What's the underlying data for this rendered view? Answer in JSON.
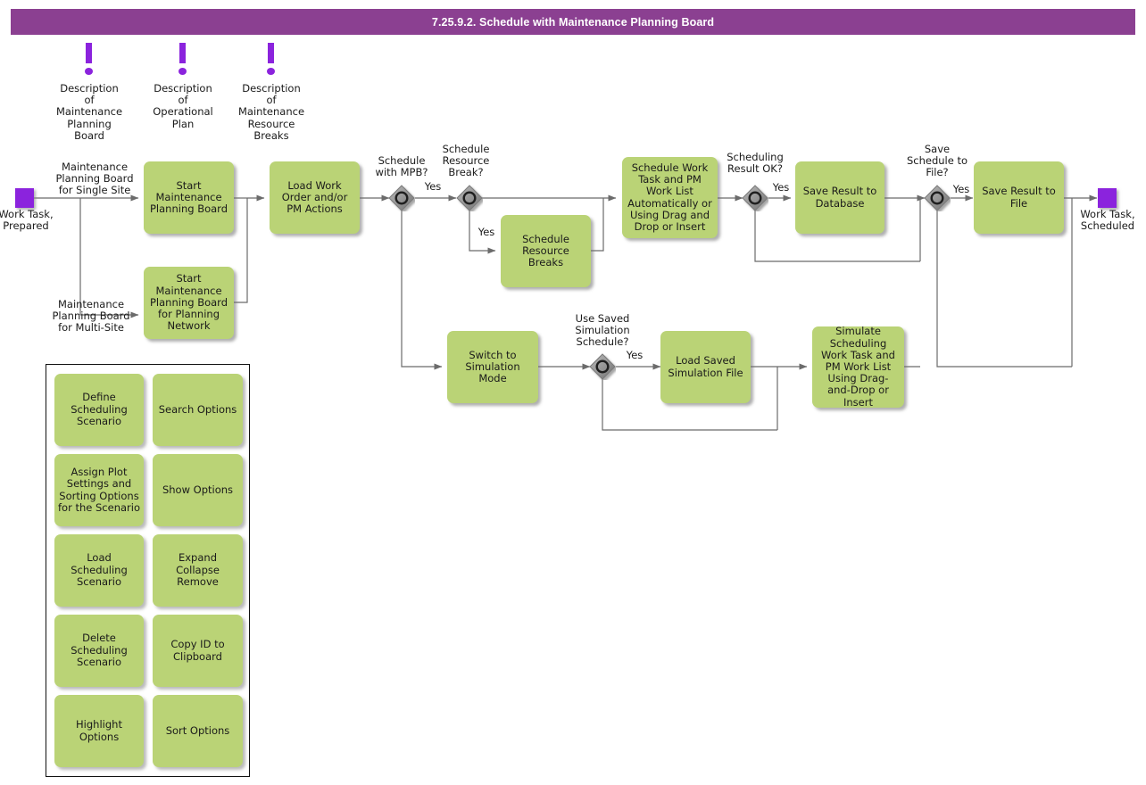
{
  "header": {
    "title": "7.25.9.2. Schedule with Maintenance Planning Board"
  },
  "colors": {
    "title_bar": "#8b4091",
    "process_fill": "#bad376",
    "event_fill": "#8b23dd",
    "gateway_fill": "#8f8f8f",
    "connector": "#6b6b6b"
  },
  "notes": [
    {
      "id": "note1",
      "label": "Description\nof\nMaintenance\nPlanning\nBoard",
      "icon": "exclamation-icon"
    },
    {
      "id": "note2",
      "label": "Description\nof\nOperational\nPlan",
      "icon": "exclamation-icon"
    },
    {
      "id": "note3",
      "label": "Description\nof\nMaintenance\nResource\nBreaks",
      "icon": "exclamation-icon"
    }
  ],
  "events": [
    {
      "id": "start",
      "label": "Work Task,\nPrepared"
    },
    {
      "id": "end",
      "label": "Work Task,\nScheduled"
    }
  ],
  "processes": [
    {
      "id": "p1",
      "label": "Start\nMaintenance\nPlanning\nBoard"
    },
    {
      "id": "p2",
      "label": "Start\nMaintenance\nPlanning Board\nfor Planning\nNetwork"
    },
    {
      "id": "p3",
      "label": "Load Work\nOrder\nand/or PM\nActions"
    },
    {
      "id": "p4",
      "label": "Schedule\nResource\nBreaks"
    },
    {
      "id": "p5",
      "label": "Schedule Work\nTask and PM\nWork List\nAutomatically or\nUsing Drag and\nDrop or Insert"
    },
    {
      "id": "p6",
      "label": "Save Result to\nDatabase"
    },
    {
      "id": "p7",
      "label": "Save Result to\nFile"
    },
    {
      "id": "p8",
      "label": "Switch to\nSimulation\nMode"
    },
    {
      "id": "p9",
      "label": "Load Saved\nSimulation File"
    },
    {
      "id": "p10",
      "label": "Simulate\nScheduling Work\nTask and PM\nWork List Using\nDrag-and-Drop\nor Insert"
    }
  ],
  "gateways": [
    {
      "id": "g1",
      "label": "Schedule\nwith MPB?"
    },
    {
      "id": "g2",
      "label": "Schedule\nResource\nBreak?"
    },
    {
      "id": "g3",
      "label": "Scheduling\nResult OK?"
    },
    {
      "id": "g4",
      "label": "Save\nSchedule to\nFile?"
    },
    {
      "id": "g5",
      "label": "Use Saved\nSimulation\nSchedule?"
    }
  ],
  "edge_labels": [
    {
      "id": "e1",
      "text": "Maintenance\nPlanning Board\nfor Single Site"
    },
    {
      "id": "e2",
      "text": "Maintenance\nPlanning Board\nfor Multi-Site"
    },
    {
      "id": "e3",
      "text": "Yes"
    },
    {
      "id": "e4",
      "text": "Yes"
    },
    {
      "id": "e5",
      "text": "Yes"
    },
    {
      "id": "e6",
      "text": "Yes"
    },
    {
      "id": "e7",
      "text": "Yes"
    },
    {
      "id": "e8",
      "text": "Yes"
    }
  ],
  "options_panel": {
    "items": [
      {
        "id": "o1",
        "label": "Define\nScheduling\nScenario"
      },
      {
        "id": "o2",
        "label": "Search\nOptions"
      },
      {
        "id": "o3",
        "label": "Assign Plot\nSettings and\nSorting Options\nfor the Scenario"
      },
      {
        "id": "o4",
        "label": "Show Options"
      },
      {
        "id": "o5",
        "label": "Load Scheduling\nScenario"
      },
      {
        "id": "o6",
        "label": "Expand\nCollapse\nRemove"
      },
      {
        "id": "o7",
        "label": "Delete\nScheduling\nScenario"
      },
      {
        "id": "o8",
        "label": "Copy ID to\nClipboard"
      },
      {
        "id": "o9",
        "label": "Highlight\nOptions"
      },
      {
        "id": "o10",
        "label": "Sort Options"
      }
    ]
  }
}
